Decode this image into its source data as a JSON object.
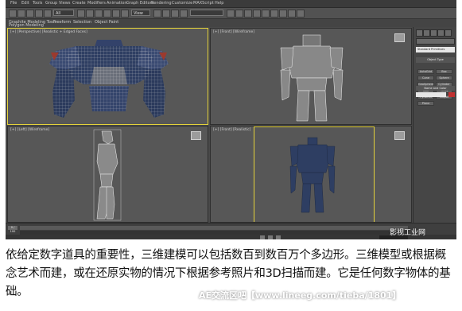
{
  "app": {
    "menus": [
      "File",
      "Edit",
      "Tools",
      "Group",
      "Views",
      "Create",
      "Modifiers",
      "Animation",
      "Graph Editors",
      "Rendering",
      "Customize",
      "MAXScript",
      "Help"
    ],
    "view_dropdown": "View",
    "selection_dropdown": "All",
    "ribbon_items": [
      "Graphite Modeling Tools",
      "Freeform",
      "Selection",
      "Object Paint"
    ],
    "ribbon_sub": "Polygon Modeling"
  },
  "viewports": [
    {
      "label": "[+] [Perspective] [Realistic + Edged Faces]",
      "view": "Perspective",
      "active": true
    },
    {
      "label": "[+] [Front] [Wireframe]",
      "view": "Front",
      "active": false
    },
    {
      "label": "[+] [Left] [Wireframe]",
      "view": "Left",
      "active": false
    },
    {
      "label": "[+] [Front] [Realistic]",
      "view": "Front",
      "active": false
    }
  ],
  "command_panel": {
    "object_name": "Standard Primitives",
    "rollout_title": "Object Type",
    "buttons": [
      "AutoGrid",
      "Box",
      "Cone",
      "Sphere",
      "GeoSphere",
      "Cylinder",
      "Tube",
      "Torus",
      "Pyramid",
      "Teapot",
      "Plane"
    ],
    "name_color": "Name and Color"
  },
  "timeline": {
    "frame": "0 / 100"
  },
  "watermark": "影视工业网",
  "caption": "依给定数字道具的重要性，三维建模可以包括数百到数百万个多边形。三维模型或根据概念艺术而建，或在还原实物的情况下根据参考照片和3D扫描而建。它是任何数字物体的基础。",
  "footer": "AE交流区吧【www.lineeg.com/tieba/1801】",
  "colors": {
    "active_border": "#e4d23b",
    "robot_blue": "#2e3e62",
    "wire": "#f2f2f2"
  }
}
